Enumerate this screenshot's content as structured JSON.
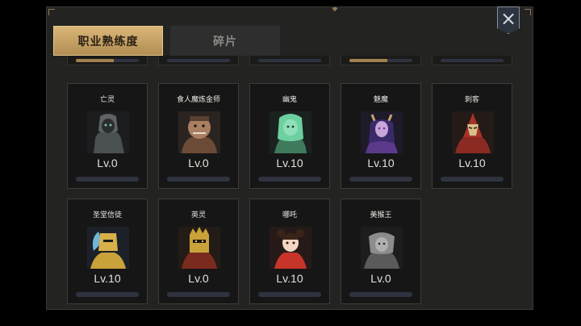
{
  "tabs": [
    {
      "label": "职业熟练度",
      "active": true
    },
    {
      "label": "碎片",
      "active": false
    }
  ],
  "close": {
    "icon": "close-icon"
  },
  "cards": [
    {
      "name": "亡灵",
      "level": "Lv.0",
      "portrait": "undead-portrait"
    },
    {
      "name": "食人魔炼金师",
      "level": "Lv.0",
      "portrait": "ogre-alchemist-portrait"
    },
    {
      "name": "幽鬼",
      "level": "Lv.10",
      "portrait": "wraith-portrait"
    },
    {
      "name": "魅魔",
      "level": "Lv.10",
      "portrait": "succubus-portrait"
    },
    {
      "name": "刺客",
      "level": "Lv.10",
      "portrait": "assassin-portrait"
    },
    {
      "name": "圣堂信徒",
      "level": "Lv.10",
      "portrait": "templar-portrait"
    },
    {
      "name": "英灵",
      "level": "Lv.0",
      "portrait": "hero-spirit-portrait"
    },
    {
      "name": "哪吒",
      "level": "Lv.10",
      "portrait": "nezha-portrait"
    },
    {
      "name": "美猴王",
      "level": "Lv.0",
      "portrait": "monkey-king-portrait"
    }
  ],
  "colors": {
    "accent": "#c9a66b",
    "panel": "#232322",
    "card": "#161616",
    "bar": "#2f3340"
  }
}
